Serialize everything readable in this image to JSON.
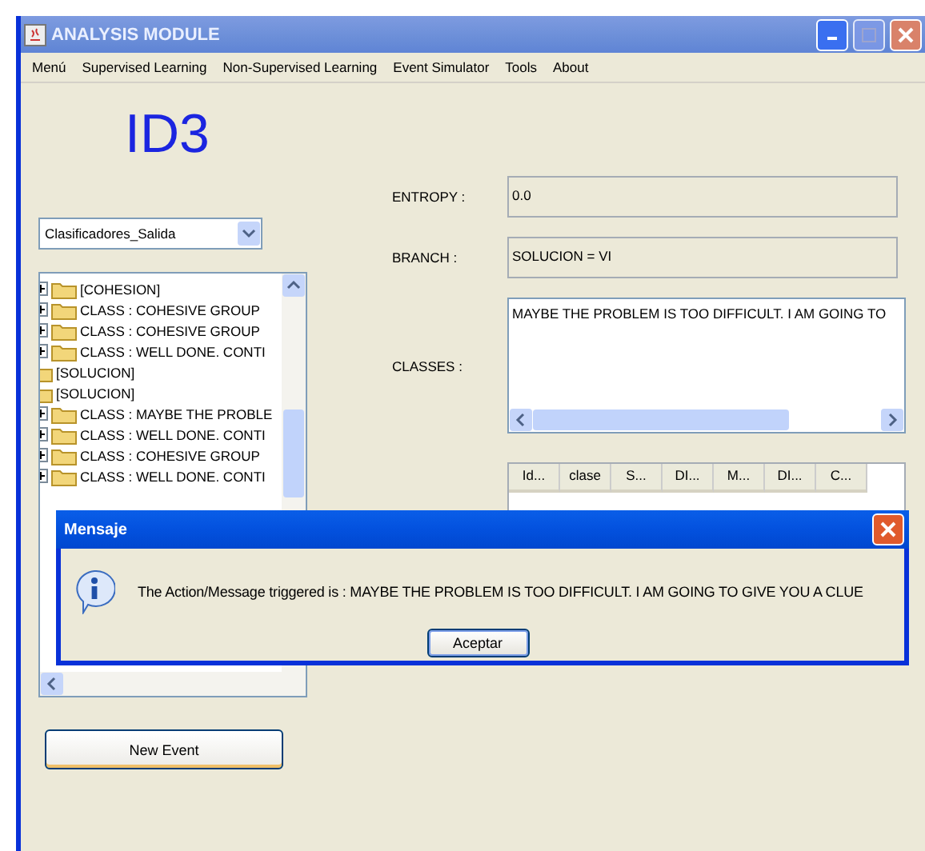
{
  "window": {
    "title": "ANALYSIS MODULE"
  },
  "menu": [
    "Menú",
    "Supervised Learning",
    "Non-Supervised Learning",
    "Event Simulator",
    "Tools",
    "About"
  ],
  "heading": "ID3",
  "classifier_select": {
    "value": "Clasificadores_Salida"
  },
  "tree": {
    "items": [
      {
        "label": "[COHESION]",
        "expanded": false
      },
      {
        "label": "CLASS : COHESIVE GROUP",
        "expanded": false
      },
      {
        "label": "CLASS : COHESIVE GROUP",
        "expanded": false
      },
      {
        "label": "CLASS : WELL DONE. CONTI",
        "expanded": false
      }
    ],
    "roots": [
      {
        "label": "[SOLUCION]"
      },
      {
        "label": "[SOLUCION]",
        "children": [
          {
            "label": "CLASS : MAYBE THE PROBLE",
            "expanded": false
          },
          {
            "label": "CLASS : WELL DONE. CONTI",
            "expanded": false
          },
          {
            "label": "CLASS : COHESIVE GROUP",
            "expanded": false
          },
          {
            "label": "CLASS : WELL DONE. CONTI",
            "expanded": false
          }
        ]
      }
    ]
  },
  "fields": [
    {
      "label": "ENTROPY :",
      "value": "0.0"
    },
    {
      "label": "BRANCH :",
      "value": "SOLUCION = VI"
    }
  ],
  "classes": {
    "label": "CLASSES :",
    "value": "MAYBE THE PROBLEM IS TOO DIFFICULT. I AM GOING TO"
  },
  "table": {
    "columns": [
      "Id...",
      "clase",
      "S...",
      "DI...",
      "M...",
      "DI...",
      "C..."
    ]
  },
  "new_event_button": "New Event",
  "dialog": {
    "title": "Mensaje",
    "message": "The Action/Message triggered is : MAYBE THE PROBLEM IS TOO DIFFICULT. I AM GOING TO GIVE YOU A CLUE",
    "button": "Aceptar"
  }
}
